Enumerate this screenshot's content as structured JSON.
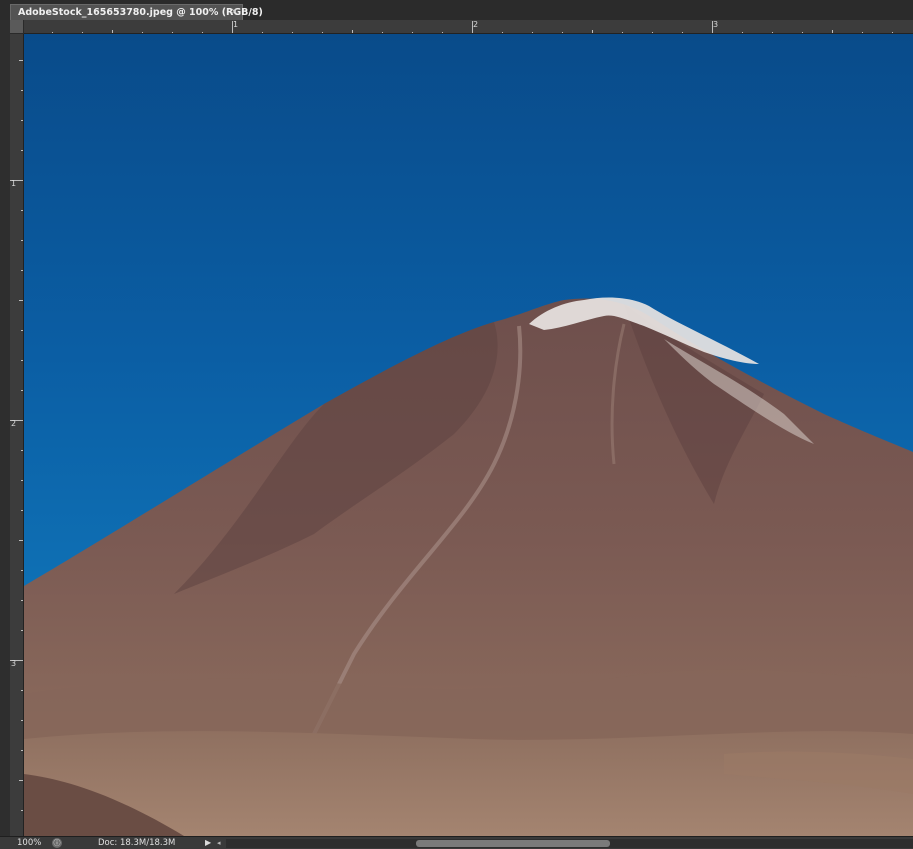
{
  "document_tab": {
    "title": "AdobeStock_165653780.jpeg @ 100% (RGB/8)",
    "close_glyph": "×"
  },
  "rulers": {
    "top_labels": [
      "1",
      "2",
      "3"
    ],
    "left_labels": [
      "1",
      "2",
      "3"
    ]
  },
  "status_bar": {
    "zoom": "100%",
    "info_icon": "info-icon",
    "doc_info": "Doc: 18.3M/18.3M",
    "play_glyph": "▶",
    "scroll_left_glyph": "◂"
  },
  "canvas": {
    "subject": "mountain-photo",
    "sky_color": "#0b5ea4",
    "mountain_color": "#7a5a52",
    "snow_color": "#e8e4e2"
  }
}
